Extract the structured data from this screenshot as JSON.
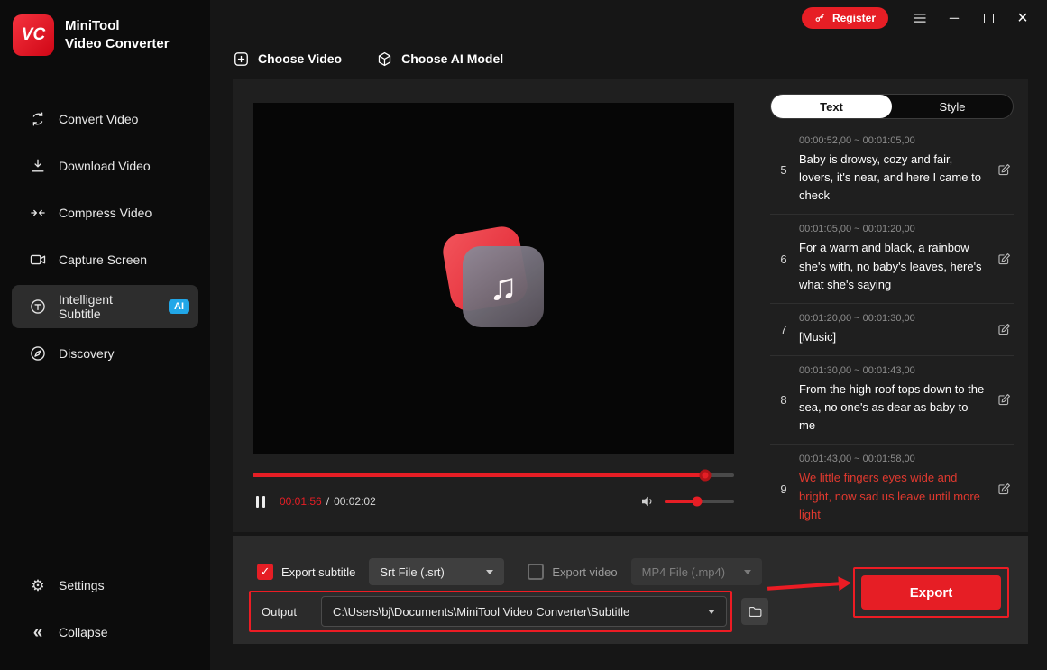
{
  "app": {
    "logo": "VC",
    "name_line1": "MiniTool",
    "name_line2": "Video Converter"
  },
  "titlebar": {
    "register_label": "Register"
  },
  "sidebar": {
    "items": [
      {
        "label": "Convert Video"
      },
      {
        "label": "Download Video"
      },
      {
        "label": "Compress Video"
      },
      {
        "label": "Capture Screen"
      },
      {
        "label": "Intelligent Subtitle",
        "badge": "AI"
      },
      {
        "label": "Discovery"
      }
    ],
    "settings_label": "Settings",
    "collapse_label": "Collapse"
  },
  "toolbar": {
    "choose_video": "Choose Video",
    "choose_ai_model": "Choose AI Model"
  },
  "player": {
    "current_time": "00:01:56",
    "separator": "/",
    "duration": "00:02:02",
    "progress_percent": 94,
    "volume_percent": 47
  },
  "subtitle_panel": {
    "tab_text": "Text",
    "tab_style": "Style",
    "entries": [
      {
        "index": "5",
        "time": "00:00:52,00 ~ 00:01:05,00",
        "text": "Baby is drowsy, cozy and fair, lovers, it's near, and here I came to check"
      },
      {
        "index": "6",
        "time": "00:01:05,00 ~ 00:01:20,00",
        "text": "For a warm and black, a rainbow she's with, no baby's leaves, here's what she's saying"
      },
      {
        "index": "7",
        "time": "00:01:20,00 ~ 00:01:30,00",
        "text": "[Music]"
      },
      {
        "index": "8",
        "time": "00:01:30,00 ~ 00:01:43,00",
        "text": "From the high roof tops down to the sea, no one's as dear as baby to me"
      },
      {
        "index": "9",
        "time": "00:01:43,00 ~ 00:01:58,00",
        "text": "We little fingers eyes wide and bright, now sad us leave until more light"
      }
    ]
  },
  "export_bar": {
    "export_subtitle_label": "Export subtitle",
    "export_subtitle_checked": true,
    "subtitle_format": "Srt File (.srt)",
    "export_video_label": "Export video",
    "export_video_checked": false,
    "video_format": "MP4 File (.mp4)",
    "output_label": "Output",
    "output_path": "C:\\Users\\bj\\Documents\\MiniTool Video Converter\\Subtitle",
    "export_button": "Export"
  },
  "icons": {
    "gear": "⚙",
    "collapse": "«",
    "close": "×",
    "music_note": "♫",
    "check": "✓"
  },
  "colors": {
    "accent": "#e61e25",
    "ai_badge": "#21a7e8",
    "highlight": "#e0392f",
    "annotation": "#ec1c24"
  }
}
